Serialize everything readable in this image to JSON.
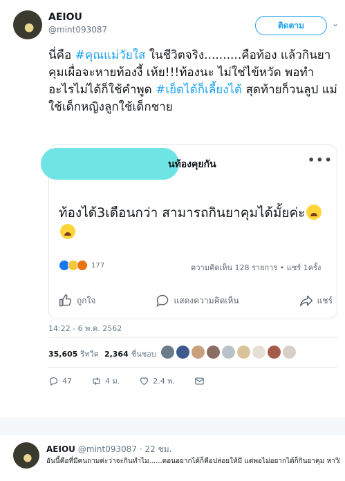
{
  "tweet": {
    "author_name": "AEIOU",
    "author_handle": "@mint093087",
    "follow_label": "ติดตาม",
    "text_parts": {
      "p1": "นี่คือ ",
      "tag1": "#คุณแม่วัยใส",
      "p2": " ในชีวิตจริง..........คือท้อง แล้วกินยาคุมเผื่อจะหายท้องงี้ เห้ย!!!ท้องนะ ไม่ใช่ไข้หวัด พอทำอะไรไม่ได้ก็ใช้คำพูด ",
      "tag2": "#เย็ดได้ก็เลี้ยงได้",
      "p3": " สุดท้ายก็วนลูป แม่ใช้เด็กหญิงลูกใช้เด็กชาย"
    },
    "timestamp": "14:22 - 6 พ.ค. 2562",
    "retweets_count": "35,605",
    "retweets_label": "รีทวีต",
    "likes_count": "2,364",
    "likes_label": "ชื่นชอบ",
    "reply_count": "47",
    "retweet_action_count": "4 ม.",
    "like_action_count": "2.4 พ."
  },
  "embedded_post": {
    "title": "นท้องคุยกัน",
    "body": "ท้องได้3เดือนกว่า สามารถกินยาคุมได้มั้ยค่ะ",
    "reaction_count": "177",
    "comments_summary": "ความคิดเห็น 128 รายการ • แชร์ 1ครั้ง",
    "like_label": "ถูกใจ",
    "comment_label": "แสดงความคิดเห็น",
    "share_label": "แชร์"
  },
  "reply": {
    "author_name": "AEIOU",
    "author_handle": "@mint093087 · 22 ชม.",
    "text": "อันนี้คือที่มีคนถามค่ะว่าจะกินทำไม......ตอนอยากได้ก็คือปล่อยให้มี แต่พอไม่อยากได้ก็กินยาคุม หาวิธีเอาออก.....นั่นลูกนะ ชีวิตอีกหนึ่งชีวิตเลยนะมันไม่ใช่ของเล่นไม่ใช่ตุ๊กตา"
  },
  "colors": {
    "accent": "#1da1f2",
    "fb_like": "#1877f2",
    "redaction": "#6ee4e4"
  },
  "icons": [
    "chevron-down-icon",
    "like-icon",
    "comment-icon",
    "share-icon",
    "reply-icon",
    "retweet-icon",
    "heart-icon",
    "message-icon"
  ]
}
